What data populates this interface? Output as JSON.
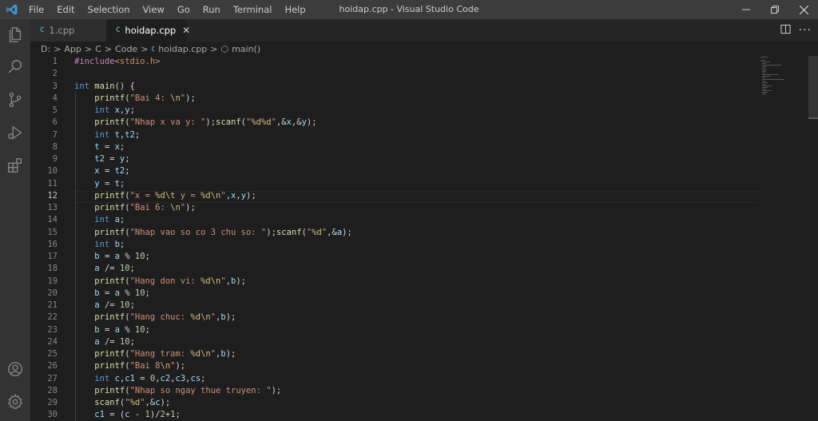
{
  "menu": [
    "File",
    "Edit",
    "Selection",
    "View",
    "Go",
    "Run",
    "Terminal",
    "Help"
  ],
  "window_title": "hoidap.cpp - Visual Studio Code",
  "tabs": [
    {
      "label": "1.cpp",
      "icon": "C"
    },
    {
      "label": "hoidap.cpp",
      "icon": "C",
      "close": "✕"
    }
  ],
  "breadcrumb": {
    "parts": [
      "D:",
      "App",
      "C",
      "Code",
      "hoidap.cpp",
      "main()"
    ],
    "sep": ">",
    "file_icon": "C",
    "fn_icon": "⬡"
  },
  "editor": {
    "active_line": 12,
    "lines": [
      {
        "n": 1,
        "tokens": [
          {
            "t": "#include",
            "c": "inc"
          },
          {
            "t": "<stdio.h>",
            "c": "hdr"
          }
        ]
      },
      {
        "n": 2,
        "tokens": []
      },
      {
        "n": 3,
        "tokens": [
          {
            "t": "int ",
            "c": "kw"
          },
          {
            "t": "main",
            "c": "fn"
          },
          {
            "t": "() {",
            "c": "op"
          }
        ]
      },
      {
        "n": 4,
        "tokens": [
          {
            "t": "    ",
            "c": "op"
          },
          {
            "t": "printf",
            "c": "fn"
          },
          {
            "t": "(",
            "c": "op"
          },
          {
            "t": "\"Bai 4: ",
            "c": "str"
          },
          {
            "t": "\\n",
            "c": "esc"
          },
          {
            "t": "\"",
            "c": "str"
          },
          {
            "t": ");",
            "c": "op"
          }
        ]
      },
      {
        "n": 5,
        "tokens": [
          {
            "t": "    ",
            "c": "op"
          },
          {
            "t": "int ",
            "c": "kw"
          },
          {
            "t": "x",
            "c": "var"
          },
          {
            "t": ",",
            "c": "op"
          },
          {
            "t": "y",
            "c": "var"
          },
          {
            "t": ";",
            "c": "op"
          }
        ]
      },
      {
        "n": 6,
        "tokens": [
          {
            "t": "    ",
            "c": "op"
          },
          {
            "t": "printf",
            "c": "fn"
          },
          {
            "t": "(",
            "c": "op"
          },
          {
            "t": "\"Nhap x va y: \"",
            "c": "str"
          },
          {
            "t": ");",
            "c": "op"
          },
          {
            "t": "scanf",
            "c": "fn"
          },
          {
            "t": "(",
            "c": "op"
          },
          {
            "t": "\"",
            "c": "str"
          },
          {
            "t": "%d%d",
            "c": "esc"
          },
          {
            "t": "\"",
            "c": "str"
          },
          {
            "t": ",&",
            "c": "op"
          },
          {
            "t": "x",
            "c": "var"
          },
          {
            "t": ",&",
            "c": "op"
          },
          {
            "t": "y",
            "c": "var"
          },
          {
            "t": ");",
            "c": "op"
          }
        ]
      },
      {
        "n": 7,
        "tokens": [
          {
            "t": "    ",
            "c": "op"
          },
          {
            "t": "int ",
            "c": "kw"
          },
          {
            "t": "t",
            "c": "var"
          },
          {
            "t": ",",
            "c": "op"
          },
          {
            "t": "t2",
            "c": "var"
          },
          {
            "t": ";",
            "c": "op"
          }
        ]
      },
      {
        "n": 8,
        "tokens": [
          {
            "t": "    ",
            "c": "op"
          },
          {
            "t": "t",
            "c": "var"
          },
          {
            "t": " = ",
            "c": "op"
          },
          {
            "t": "x",
            "c": "var"
          },
          {
            "t": ";",
            "c": "op"
          }
        ]
      },
      {
        "n": 9,
        "tokens": [
          {
            "t": "    ",
            "c": "op"
          },
          {
            "t": "t2",
            "c": "var"
          },
          {
            "t": " = ",
            "c": "op"
          },
          {
            "t": "y",
            "c": "var"
          },
          {
            "t": ";",
            "c": "op"
          }
        ]
      },
      {
        "n": 10,
        "tokens": [
          {
            "t": "    ",
            "c": "op"
          },
          {
            "t": "x",
            "c": "var"
          },
          {
            "t": " = ",
            "c": "op"
          },
          {
            "t": "t2",
            "c": "var"
          },
          {
            "t": ";",
            "c": "op"
          }
        ]
      },
      {
        "n": 11,
        "tokens": [
          {
            "t": "    ",
            "c": "op"
          },
          {
            "t": "y",
            "c": "var"
          },
          {
            "t": " = ",
            "c": "op"
          },
          {
            "t": "t",
            "c": "var"
          },
          {
            "t": ";",
            "c": "op"
          }
        ]
      },
      {
        "n": 12,
        "tokens": [
          {
            "t": "    ",
            "c": "op"
          },
          {
            "t": "printf",
            "c": "fn"
          },
          {
            "t": "(",
            "c": "op"
          },
          {
            "t": "\"x = ",
            "c": "str"
          },
          {
            "t": "%d\\t",
            "c": "esc"
          },
          {
            "t": " y = ",
            "c": "str"
          },
          {
            "t": "%d\\n",
            "c": "esc"
          },
          {
            "t": "\"",
            "c": "str"
          },
          {
            "t": ",",
            "c": "op"
          },
          {
            "t": "x",
            "c": "var"
          },
          {
            "t": ",",
            "c": "op"
          },
          {
            "t": "y",
            "c": "var"
          },
          {
            "t": ");",
            "c": "op"
          }
        ]
      },
      {
        "n": 13,
        "tokens": [
          {
            "t": "    ",
            "c": "op"
          },
          {
            "t": "printf",
            "c": "fn"
          },
          {
            "t": "(",
            "c": "op"
          },
          {
            "t": "\"Bai 6: ",
            "c": "str"
          },
          {
            "t": "\\n",
            "c": "esc"
          },
          {
            "t": "\"",
            "c": "str"
          },
          {
            "t": ");",
            "c": "op"
          }
        ]
      },
      {
        "n": 14,
        "tokens": [
          {
            "t": "    ",
            "c": "op"
          },
          {
            "t": "int ",
            "c": "kw"
          },
          {
            "t": "a",
            "c": "var"
          },
          {
            "t": ";",
            "c": "op"
          }
        ]
      },
      {
        "n": 15,
        "tokens": [
          {
            "t": "    ",
            "c": "op"
          },
          {
            "t": "printf",
            "c": "fn"
          },
          {
            "t": "(",
            "c": "op"
          },
          {
            "t": "\"Nhap vao so co 3 chu so: \"",
            "c": "str"
          },
          {
            "t": ");",
            "c": "op"
          },
          {
            "t": "scanf",
            "c": "fn"
          },
          {
            "t": "(",
            "c": "op"
          },
          {
            "t": "\"",
            "c": "str"
          },
          {
            "t": "%d",
            "c": "esc"
          },
          {
            "t": "\"",
            "c": "str"
          },
          {
            "t": ",&",
            "c": "op"
          },
          {
            "t": "a",
            "c": "var"
          },
          {
            "t": ");",
            "c": "op"
          }
        ]
      },
      {
        "n": 16,
        "tokens": [
          {
            "t": "    ",
            "c": "op"
          },
          {
            "t": "int ",
            "c": "kw"
          },
          {
            "t": "b",
            "c": "var"
          },
          {
            "t": ";",
            "c": "op"
          }
        ]
      },
      {
        "n": 17,
        "tokens": [
          {
            "t": "    ",
            "c": "op"
          },
          {
            "t": "b",
            "c": "var"
          },
          {
            "t": " = ",
            "c": "op"
          },
          {
            "t": "a",
            "c": "var"
          },
          {
            "t": " % ",
            "c": "op"
          },
          {
            "t": "10",
            "c": "num"
          },
          {
            "t": ";",
            "c": "op"
          }
        ]
      },
      {
        "n": 18,
        "tokens": [
          {
            "t": "    ",
            "c": "op"
          },
          {
            "t": "a",
            "c": "var"
          },
          {
            "t": " /= ",
            "c": "op"
          },
          {
            "t": "10",
            "c": "num"
          },
          {
            "t": ";",
            "c": "op"
          }
        ]
      },
      {
        "n": 19,
        "tokens": [
          {
            "t": "    ",
            "c": "op"
          },
          {
            "t": "printf",
            "c": "fn"
          },
          {
            "t": "(",
            "c": "op"
          },
          {
            "t": "\"Hang don vi: ",
            "c": "str"
          },
          {
            "t": "%d\\n",
            "c": "esc"
          },
          {
            "t": "\"",
            "c": "str"
          },
          {
            "t": ",",
            "c": "op"
          },
          {
            "t": "b",
            "c": "var"
          },
          {
            "t": ");",
            "c": "op"
          }
        ]
      },
      {
        "n": 20,
        "tokens": [
          {
            "t": "    ",
            "c": "op"
          },
          {
            "t": "b",
            "c": "var"
          },
          {
            "t": " = ",
            "c": "op"
          },
          {
            "t": "a",
            "c": "var"
          },
          {
            "t": " % ",
            "c": "op"
          },
          {
            "t": "10",
            "c": "num"
          },
          {
            "t": ";",
            "c": "op"
          }
        ]
      },
      {
        "n": 21,
        "tokens": [
          {
            "t": "    ",
            "c": "op"
          },
          {
            "t": "a",
            "c": "var"
          },
          {
            "t": " /= ",
            "c": "op"
          },
          {
            "t": "10",
            "c": "num"
          },
          {
            "t": ";",
            "c": "op"
          }
        ]
      },
      {
        "n": 22,
        "tokens": [
          {
            "t": "    ",
            "c": "op"
          },
          {
            "t": "printf",
            "c": "fn"
          },
          {
            "t": "(",
            "c": "op"
          },
          {
            "t": "\"Hang chuc: ",
            "c": "str"
          },
          {
            "t": "%d\\n",
            "c": "esc"
          },
          {
            "t": "\"",
            "c": "str"
          },
          {
            "t": ",",
            "c": "op"
          },
          {
            "t": "b",
            "c": "var"
          },
          {
            "t": ");",
            "c": "op"
          }
        ]
      },
      {
        "n": 23,
        "tokens": [
          {
            "t": "    ",
            "c": "op"
          },
          {
            "t": "b",
            "c": "var"
          },
          {
            "t": " = ",
            "c": "op"
          },
          {
            "t": "a",
            "c": "var"
          },
          {
            "t": " % ",
            "c": "op"
          },
          {
            "t": "10",
            "c": "num"
          },
          {
            "t": ";",
            "c": "op"
          }
        ]
      },
      {
        "n": 24,
        "tokens": [
          {
            "t": "    ",
            "c": "op"
          },
          {
            "t": "a",
            "c": "var"
          },
          {
            "t": " /= ",
            "c": "op"
          },
          {
            "t": "10",
            "c": "num"
          },
          {
            "t": ";",
            "c": "op"
          }
        ]
      },
      {
        "n": 25,
        "tokens": [
          {
            "t": "    ",
            "c": "op"
          },
          {
            "t": "printf",
            "c": "fn"
          },
          {
            "t": "(",
            "c": "op"
          },
          {
            "t": "\"Hang tram: ",
            "c": "str"
          },
          {
            "t": "%d\\n",
            "c": "esc"
          },
          {
            "t": "\"",
            "c": "str"
          },
          {
            "t": ",",
            "c": "op"
          },
          {
            "t": "b",
            "c": "var"
          },
          {
            "t": ");",
            "c": "op"
          }
        ]
      },
      {
        "n": 26,
        "tokens": [
          {
            "t": "    ",
            "c": "op"
          },
          {
            "t": "printf",
            "c": "fn"
          },
          {
            "t": "(",
            "c": "op"
          },
          {
            "t": "\"Bai 8",
            "c": "str"
          },
          {
            "t": "\\n",
            "c": "esc"
          },
          {
            "t": "\"",
            "c": "str"
          },
          {
            "t": ");",
            "c": "op"
          }
        ]
      },
      {
        "n": 27,
        "tokens": [
          {
            "t": "    ",
            "c": "op"
          },
          {
            "t": "int ",
            "c": "kw"
          },
          {
            "t": "c",
            "c": "var"
          },
          {
            "t": ",",
            "c": "op"
          },
          {
            "t": "c1",
            "c": "var"
          },
          {
            "t": " = ",
            "c": "op"
          },
          {
            "t": "0",
            "c": "num"
          },
          {
            "t": ",",
            "c": "op"
          },
          {
            "t": "c2",
            "c": "var"
          },
          {
            "t": ",",
            "c": "op"
          },
          {
            "t": "c3",
            "c": "var"
          },
          {
            "t": ",",
            "c": "op"
          },
          {
            "t": "cs",
            "c": "var"
          },
          {
            "t": ";",
            "c": "op"
          }
        ]
      },
      {
        "n": 28,
        "tokens": [
          {
            "t": "    ",
            "c": "op"
          },
          {
            "t": "printf",
            "c": "fn"
          },
          {
            "t": "(",
            "c": "op"
          },
          {
            "t": "\"Nhap so ngay thue truyen: \"",
            "c": "str"
          },
          {
            "t": ");",
            "c": "op"
          }
        ]
      },
      {
        "n": 29,
        "tokens": [
          {
            "t": "    ",
            "c": "op"
          },
          {
            "t": "scanf",
            "c": "fn"
          },
          {
            "t": "(",
            "c": "op"
          },
          {
            "t": "\"",
            "c": "str"
          },
          {
            "t": "%d",
            "c": "esc"
          },
          {
            "t": "\"",
            "c": "str"
          },
          {
            "t": ",&",
            "c": "op"
          },
          {
            "t": "c",
            "c": "var"
          },
          {
            "t": ");",
            "c": "op"
          }
        ]
      },
      {
        "n": 30,
        "tokens": [
          {
            "t": "    ",
            "c": "op"
          },
          {
            "t": "c1",
            "c": "var"
          },
          {
            "t": " = (",
            "c": "op"
          },
          {
            "t": "c",
            "c": "var"
          },
          {
            "t": " - ",
            "c": "op"
          },
          {
            "t": "1",
            "c": "num"
          },
          {
            "t": ")/",
            "c": "op"
          },
          {
            "t": "2",
            "c": "num"
          },
          {
            "t": "+",
            "c": "op"
          },
          {
            "t": "1",
            "c": "num"
          },
          {
            "t": ";",
            "c": "op"
          }
        ]
      }
    ]
  },
  "colors": {
    "titlebar": "#3c3c3c",
    "activitybar": "#333333",
    "editor_bg": "#1e1e1e",
    "accent_logo": "#3b9be0"
  }
}
